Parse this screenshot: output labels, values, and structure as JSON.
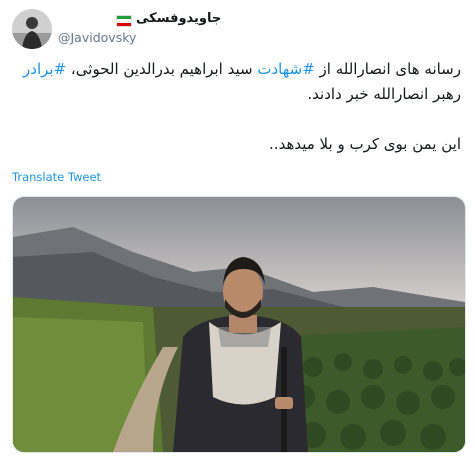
{
  "tweet": {
    "display_name": "جاویدوفسکی",
    "handle": "@Javidovsky",
    "text_line1_prefix": "رسانه های انصارالله از ",
    "hashtag1": "#شهادت",
    "text_line1_mid": " سید ابراهیم بدرالدین الحوثی، ",
    "hashtag2": "#برادر",
    "text_line2": "رهبر انصارالله خبر دادند.",
    "text_line3": "این یمن بوی کرب و بلا میدهد..",
    "translate_label": "Translate Tweet"
  },
  "icons": {
    "flag": "iran-flag-icon"
  },
  "colors": {
    "link": "#1b95e0",
    "text": "#14171a",
    "secondary": "#657786"
  }
}
